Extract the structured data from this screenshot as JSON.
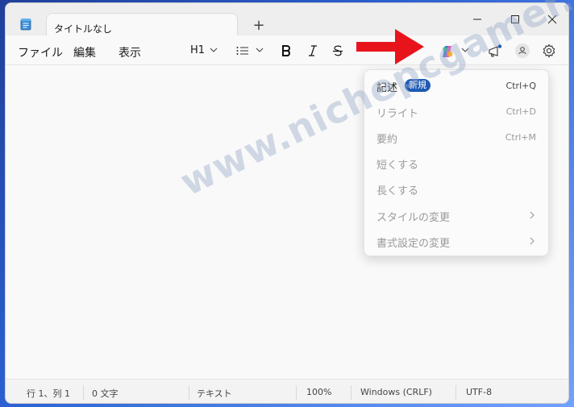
{
  "window": {
    "tab_title": "タイトルなし",
    "new_tab_symbol": "+"
  },
  "menubar": {
    "file": "ファイル",
    "edit": "編集",
    "view": "表示"
  },
  "toolbar": {
    "heading": "H1"
  },
  "dropdown": {
    "items": [
      {
        "label": "記述",
        "badge": "新規",
        "shortcut": "Ctrl+Q",
        "enabled": true
      },
      {
        "label": "リライト",
        "shortcut": "Ctrl+D",
        "enabled": false
      },
      {
        "label": "要約",
        "shortcut": "Ctrl+M",
        "enabled": false
      },
      {
        "label": "短くする",
        "enabled": false
      },
      {
        "label": "長くする",
        "enabled": false
      },
      {
        "label": "スタイルの変更",
        "submenu": true,
        "enabled": false
      },
      {
        "label": "書式設定の変更",
        "submenu": true,
        "enabled": false
      }
    ]
  },
  "statusbar": {
    "position": "行 1、列 1",
    "chars": "0 文字",
    "format": "テキスト",
    "zoom": "100%",
    "line_ending": "Windows (CRLF)",
    "encoding": "UTF-8"
  },
  "watermark": "www.nichepcgamer.com",
  "colors": {
    "accent": "#1e5bb6",
    "arrow": "#e8141b"
  }
}
